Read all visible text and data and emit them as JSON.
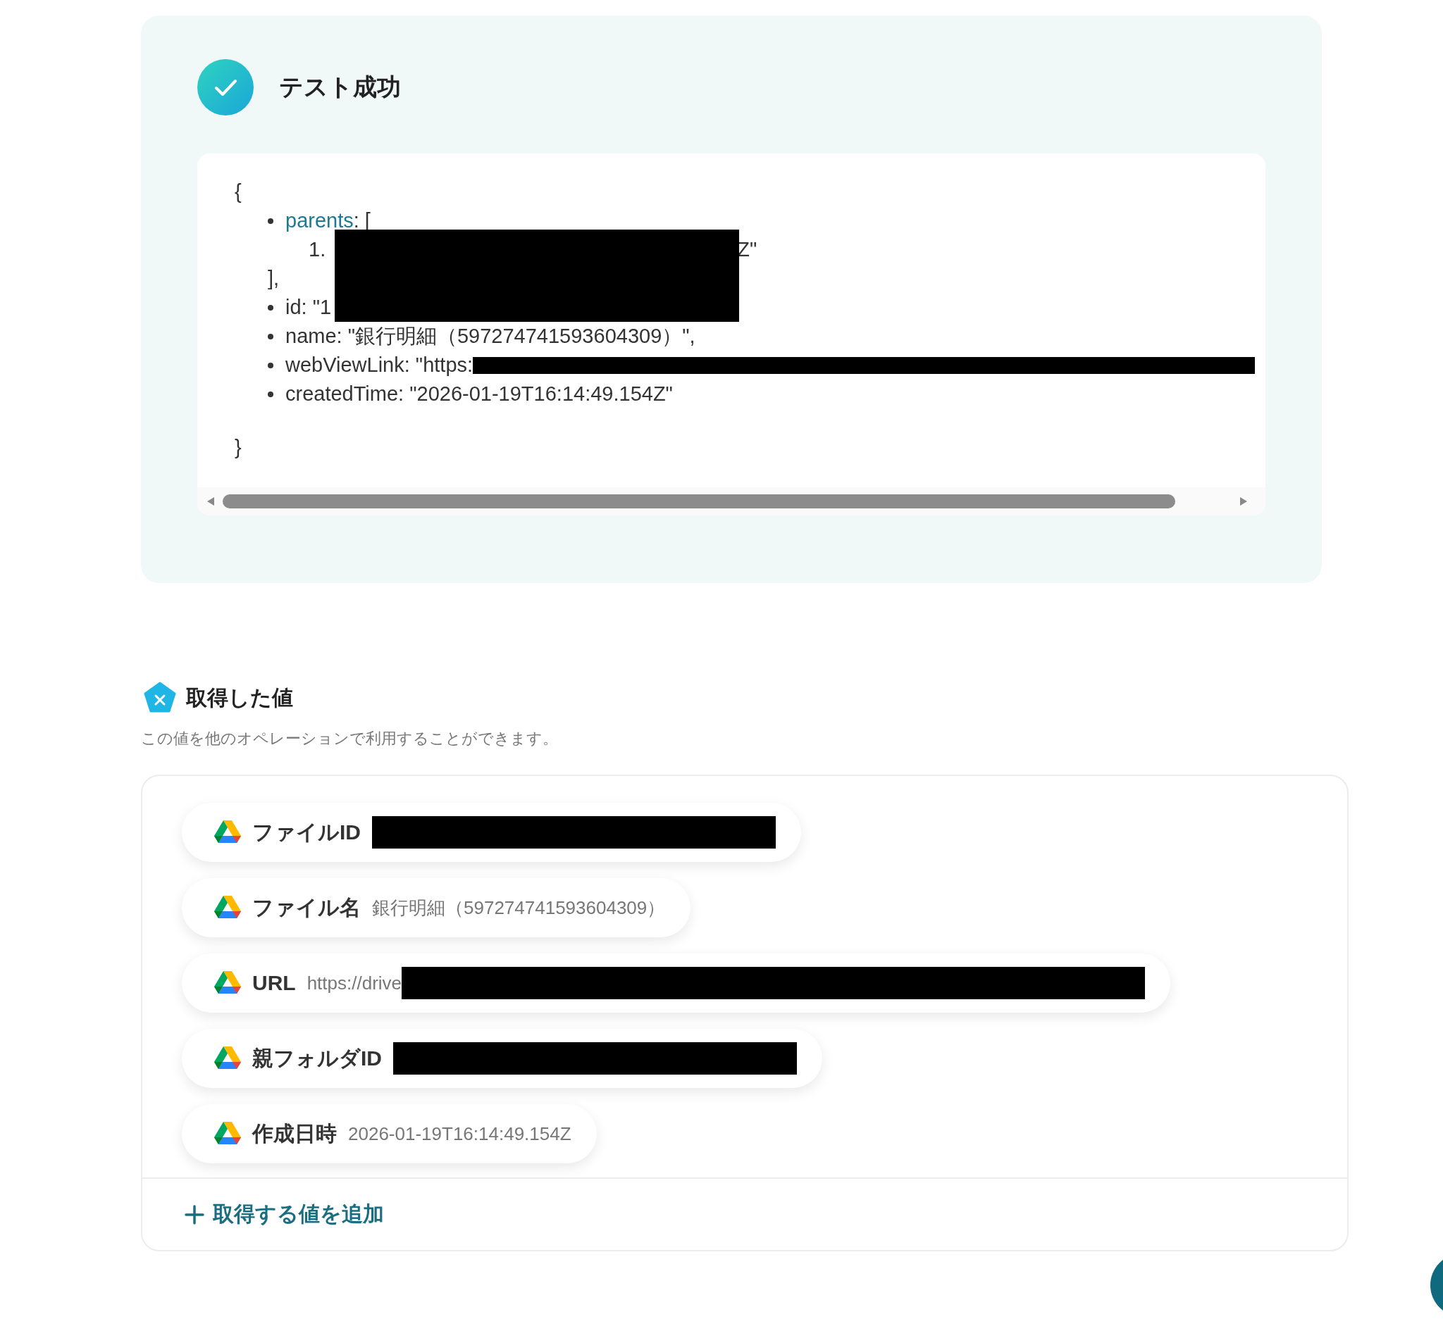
{
  "result": {
    "title": "テスト成功",
    "code": {
      "open": "{",
      "close": "}",
      "redacted": true,
      "entries": [
        {
          "key": "parents",
          "kind": "link",
          "value": ": [",
          "items": [
            {
              "index": "1.",
              "tail": "Z\""
            }
          ],
          "end": "],"
        },
        {
          "key": "id",
          "kind": "plain",
          "value": ": \"1"
        },
        {
          "key": "name",
          "kind": "plain",
          "value": ": \"銀行明細（597274741593604309）\","
        },
        {
          "key": "webViewLink",
          "kind": "plain",
          "value": ": \"https:",
          "redacted": true
        },
        {
          "key": "createdTime",
          "kind": "plain",
          "value": ": \"2026-01-19T16:14:49.154Z\""
        }
      ]
    }
  },
  "values": {
    "title": "取得した値",
    "description": "この値を他のオペレーションで利用することができます。",
    "items": [
      {
        "label": "ファイルID",
        "redacted": true
      },
      {
        "label": "ファイル名",
        "value": "銀行明細（597274741593604309）",
        "redacted": false
      },
      {
        "label": "URL",
        "value": "https://drive",
        "redacted": true
      },
      {
        "label": "親フォルダID",
        "redacted": true
      },
      {
        "label": "作成日時",
        "value": "2026-01-19T16:14:49.154Z",
        "redacted": false
      }
    ],
    "add_button": "取得する値を追加"
  }
}
